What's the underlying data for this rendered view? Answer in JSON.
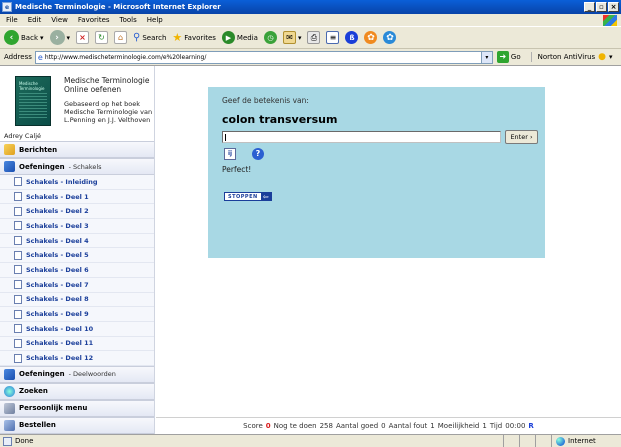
{
  "window": {
    "title": "Medische Terminologie - Microsoft Internet Explorer"
  },
  "menu": [
    "File",
    "Edit",
    "View",
    "Favorites",
    "Tools",
    "Help"
  ],
  "toolbar": {
    "back": "Back",
    "search": "Search",
    "favorites": "Favorites",
    "media": "Media"
  },
  "address": {
    "label": "Address",
    "url": "http://www.medischeterminologie.com/e%20learning/",
    "go": "Go",
    "antivirus": "Norton AntiVirus"
  },
  "sidebar": {
    "book_text": "Medische Terminologie",
    "title_line1": "Medische Terminologie",
    "title_line2": "Online oefenen",
    "sub_line1": "Gebaseerd op het boek",
    "sub_line2": "Medische Terminologie van",
    "sub_line3": "L.Penning en J.J. Velthoven",
    "author": "Adrey Caljé",
    "sections": {
      "berichten": "Berichten",
      "oefeningen1": "Oefeningen",
      "oefeningen1_sub": "- Schakels",
      "oefeningen2": "Oefeningen",
      "oefeningen2_sub": "- Deelwoorden",
      "zoeken": "Zoeken",
      "persoonlijk": "Persoonlijk menu",
      "bestellen": "Bestellen"
    },
    "items": [
      "Schakels - Inleiding",
      "Schakels - Deel 1",
      "Schakels - Deel 2",
      "Schakels - Deel 3",
      "Schakels - Deel 4",
      "Schakels - Deel 5",
      "Schakels - Deel 6",
      "Schakels - Deel 7",
      "Schakels - Deel 8",
      "Schakels - Deel 9",
      "Schakels - Deel 10",
      "Schakels - Deel 11",
      "Schakels - Deel 12"
    ]
  },
  "quiz": {
    "prompt": "Geef de betekenis van:",
    "term": "colon transversum",
    "answer_value": "",
    "enter_label": "Enter ›",
    "feedback": "Perfect!",
    "stop_label": "STOPPEN",
    "icon_label": "ij"
  },
  "score": {
    "score_label": "Score",
    "score_value": "0",
    "todo_label": "Nog te doen",
    "todo_value": "258",
    "good_label": "Aantal goed",
    "good_value": "0",
    "wrong_label": "Aantal fout",
    "wrong_value": "1",
    "difficulty_label": "Moeilijkheid",
    "difficulty_value": "1",
    "time_label": "Tijd",
    "time_value": "00:00",
    "reset": "R"
  },
  "status": {
    "text": "Done",
    "zone": "Internet"
  }
}
